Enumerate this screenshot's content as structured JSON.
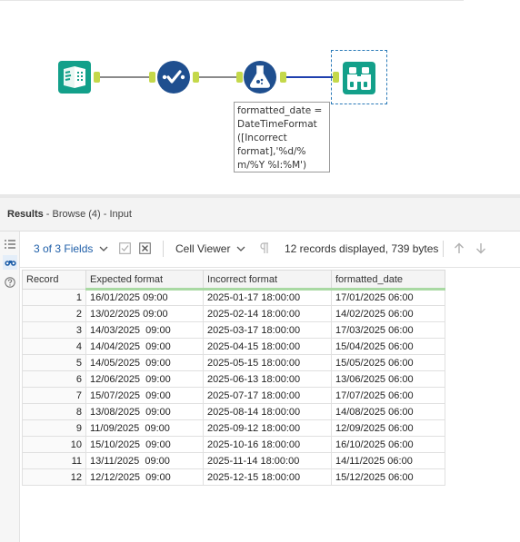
{
  "workflow": {
    "tools": [
      {
        "name": "input-data-icon"
      },
      {
        "name": "select-icon"
      },
      {
        "name": "formula-icon"
      },
      {
        "name": "browse-icon"
      }
    ],
    "annotation": "formatted_date =\nDateTimeFormat\n([Incorrect\nformat],'%d/%\nm/%Y %I:%M')"
  },
  "results": {
    "title": "Results",
    "subtitle": " - Browse (4) - Input"
  },
  "toolbar": {
    "fields_label": "3 of 3 Fields",
    "viewer_label": "Cell Viewer",
    "records_text": "12 records displayed, 739 bytes"
  },
  "table": {
    "headers": [
      "Record",
      "Expected format",
      "Incorrect format",
      "formatted_date"
    ],
    "rows": [
      [
        "1",
        "16/01/2025 09:00",
        "2025-01-17 18:00:00",
        "17/01/2025 06:00"
      ],
      [
        "2",
        "13/02/2025 09:00",
        "2025-02-14 18:00:00",
        "14/02/2025 06:00"
      ],
      [
        "3",
        "14/03/2025  09:00",
        "2025-03-17 18:00:00",
        "17/03/2025 06:00"
      ],
      [
        "4",
        "14/04/2025  09:00",
        "2025-04-15 18:00:00",
        "15/04/2025 06:00"
      ],
      [
        "5",
        "14/05/2025  09:00",
        "2025-05-15 18:00:00",
        "15/05/2025 06:00"
      ],
      [
        "6",
        "12/06/2025  09:00",
        "2025-06-13 18:00:00",
        "13/06/2025 06:00"
      ],
      [
        "7",
        "15/07/2025  09:00",
        "2025-07-17 18:00:00",
        "17/07/2025 06:00"
      ],
      [
        "8",
        "13/08/2025  09:00",
        "2025-08-14 18:00:00",
        "14/08/2025 06:00"
      ],
      [
        "9",
        "11/09/2025  09:00",
        "2025-09-12 18:00:00",
        "12/09/2025 06:00"
      ],
      [
        "10",
        "15/10/2025  09:00",
        "2025-10-16 18:00:00",
        "16/10/2025 06:00"
      ],
      [
        "11",
        "13/11/2025  09:00",
        "2025-11-14 18:00:00",
        "14/11/2025 06:00"
      ],
      [
        "12",
        "12/12/2025  09:00",
        "2025-12-15 18:00:00",
        "15/12/2025 06:00"
      ]
    ]
  },
  "colors": {
    "tool_teal": "#13a08a",
    "tool_blue": "#1f4f8f",
    "anchor_green": "#c4d84a",
    "link_blue": "#1e5ea8"
  }
}
